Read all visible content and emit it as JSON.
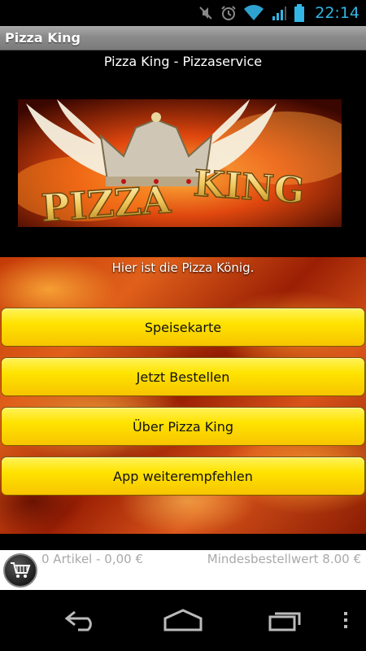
{
  "status_bar": {
    "time": "22:14",
    "icons": [
      "mute-icon",
      "alarm-icon",
      "wifi-icon",
      "signal-icon",
      "battery-icon"
    ],
    "accent_color": "#33b5e5"
  },
  "app": {
    "title": "Pizza King"
  },
  "header": {
    "subtitle": "Pizza King - Pizzaservice",
    "logo_text": "PIZZA KING"
  },
  "main": {
    "tagline": "Hier ist die Pizza König.",
    "menu": [
      {
        "label": "Speisekarte"
      },
      {
        "label": "Jetzt Bestellen"
      },
      {
        "label": "Über Pizza King"
      },
      {
        "label": "App weiterempfehlen"
      }
    ],
    "button_color": "#ffe300"
  },
  "cart": {
    "summary": "0 Artikel - 0,00 €",
    "minimum": "Mindesbestellwert 8.00 €"
  },
  "nav": {
    "icons": [
      "back-icon",
      "home-icon",
      "recent-apps-icon",
      "overflow-menu-icon"
    ]
  }
}
